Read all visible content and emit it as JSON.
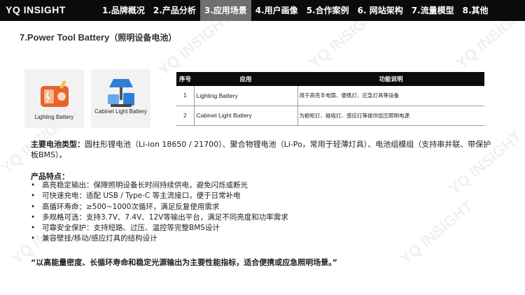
{
  "header": {
    "brand": "YQ INSIGHT",
    "tabs": [
      {
        "label": "1.品牌概况",
        "active": false
      },
      {
        "label": "2.产品分析",
        "active": false
      },
      {
        "label": "3.应用场景",
        "active": true
      },
      {
        "label": "4.用户画像",
        "active": false
      },
      {
        "label": "5.合作案例",
        "active": false
      },
      {
        "label": "6. 网站架构",
        "active": false
      },
      {
        "label": "7.流量模型",
        "active": false
      },
      {
        "label": "8.其他",
        "active": false
      }
    ]
  },
  "page": {
    "title_en": "7.Power Tool Battery",
    "title_cn": "（照明设备电池）"
  },
  "cards": [
    {
      "label": "Lighting Battery",
      "icon": "lighting-battery-icon"
    },
    {
      "label": "Cabinet Light Battery",
      "icon": "cabinet-light-icon"
    }
  ],
  "table": {
    "headers": [
      "序号",
      "应用",
      "功能说明"
    ],
    "rows": [
      {
        "num": "1",
        "app": "Lighting Battery",
        "desc": "用于高亮手电筒、便携灯、应急灯具等设备"
      },
      {
        "num": "2",
        "app": "Cabinet Light Battery",
        "desc": "为橱柜灯、磁吸灯、感应灯等提供低压照明电源"
      }
    ]
  },
  "battery_types": {
    "label": "主要电池类型：",
    "text": "圆柱形锂电池（Li-ion 18650 / 21700）、聚合物锂电池（Li-Po，常用于轻薄灯具）、电池组模组（支持串并联、带保护板BMS）。"
  },
  "features": {
    "title": "产品特点：",
    "items": [
      "高亮稳定输出：保障照明设备长时间持续供电，避免闪烁或断光",
      "可快速充电：适配 USB / Type-C 等主流接口，便于日常补电",
      "高循环寿命：≥500~1000次循环，满足反复使用需求",
      "多规格可选：支持3.7V、7.4V、12V等输出平台，满足不同亮度和功率需求",
      "可靠安全保护：支持短路、过压、温控等完整BMS设计",
      "兼容壁挂/移动/感应灯具的结构设计"
    ]
  },
  "summary": "“以高能量密度、长循环寿命和稳定光源输出为主要性能指标，适合便携或应急照明场景。”",
  "watermark": "YQ INSIGHT",
  "colors": {
    "topbar": "#0b0b0b",
    "active_tab": "#6f6f6f",
    "accent_orange": "#e8632c",
    "accent_blue": "#2f7fd8"
  }
}
